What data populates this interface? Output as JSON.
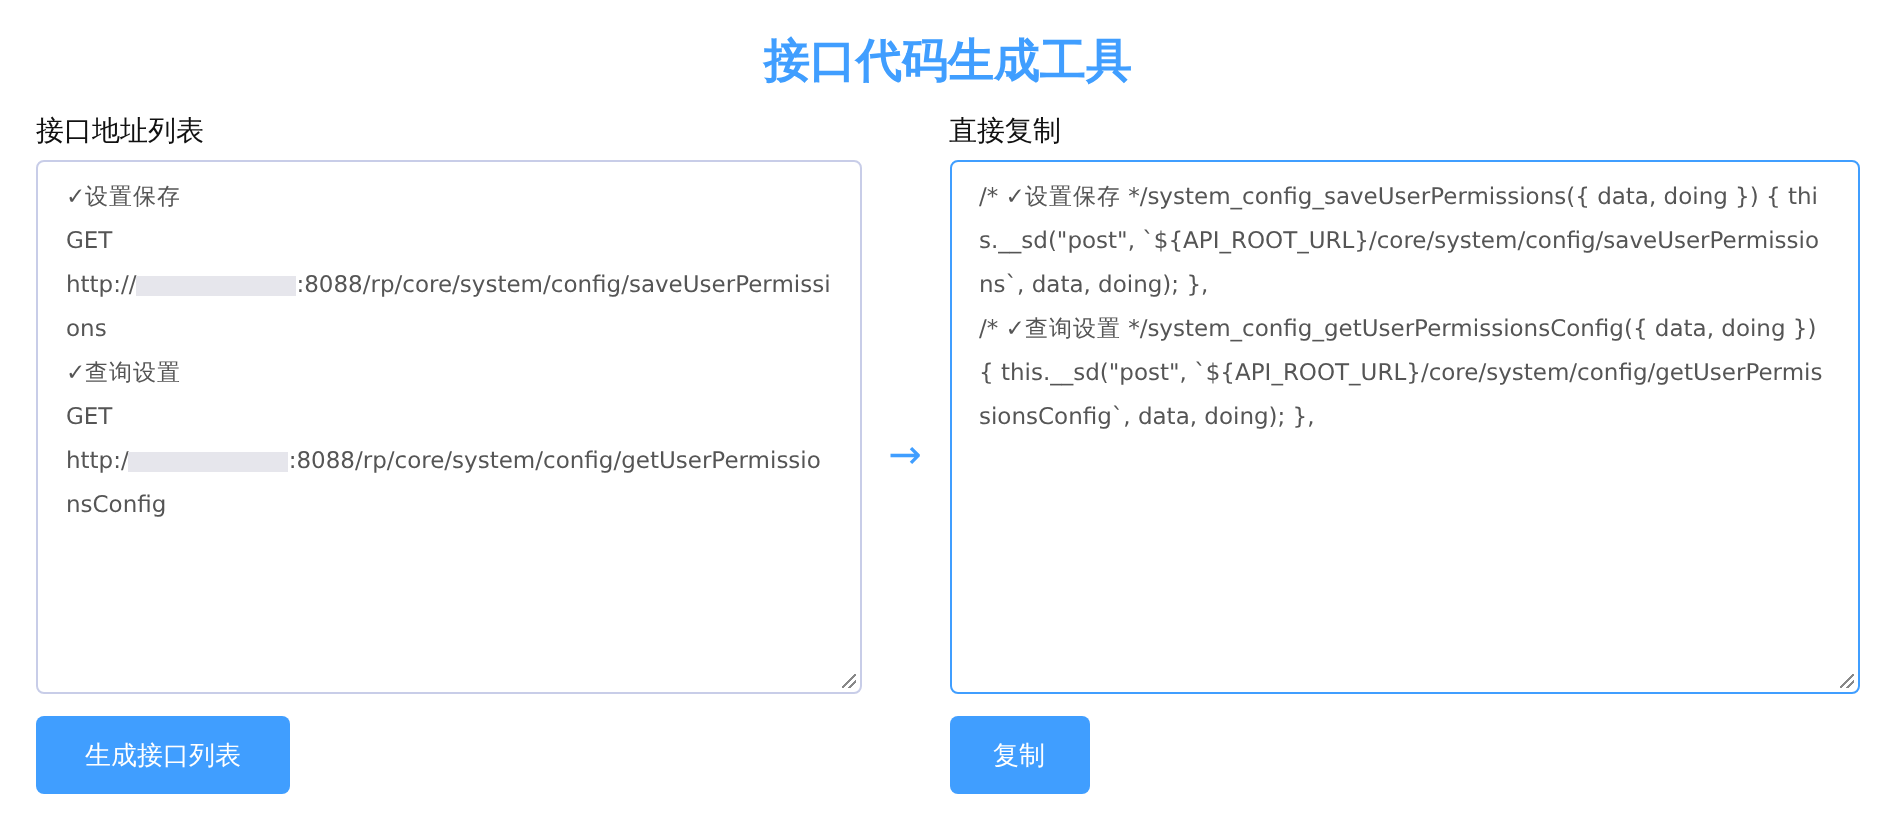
{
  "title": "接口代码生成工具",
  "left": {
    "label": "接口地址列表",
    "entries": [
      {
        "name": "✓设置保存",
        "method": "GET",
        "url_prefix": "http://",
        "url_suffix": ":8088/rp/core/system/config/saveUserPermissions"
      },
      {
        "name": "✓查询设置",
        "method": "GET",
        "url_prefix": "http:/",
        "url_suffix": ":8088/rp/core/system/config/getUserPermissionsConfig"
      }
    ],
    "button": "生成接口列表"
  },
  "arrow": "→",
  "right": {
    "label": "直接复制",
    "lines": [
      "/* ✓设置保存 */system_config_saveUserPermissions({ data, doing }) { this.__sd(\"post\", `${API_ROOT_URL}/core/system/config/saveUserPermissions`, data, doing); },",
      "/* ✓查询设置 */system_config_getUserPermissionsConfig({ data, doing }) { this.__sd(\"post\", `${API_ROOT_URL}/core/system/config/getUserPermissionsConfig`, data, doing); },"
    ],
    "button": "复制"
  }
}
